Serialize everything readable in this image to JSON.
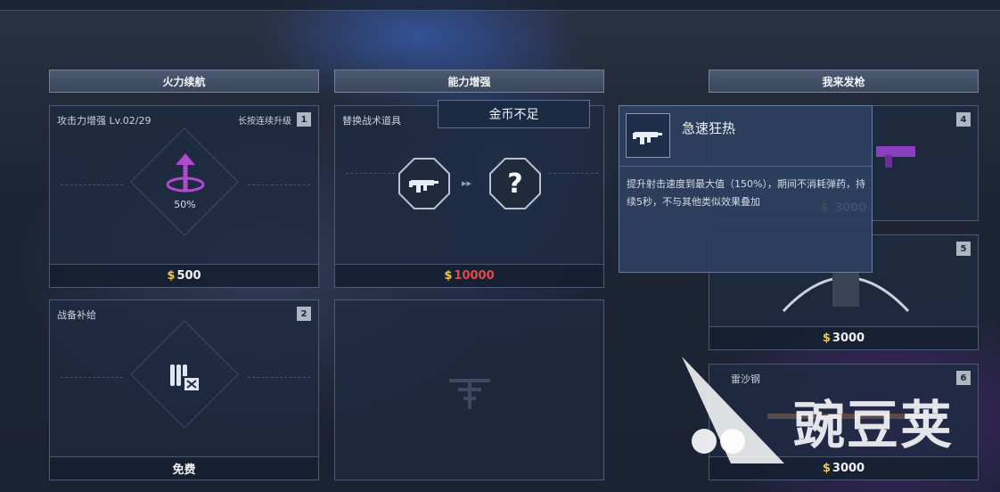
{
  "columns": [
    {
      "header": "火力续航"
    },
    {
      "header": "能力增强"
    },
    {
      "header": "我来发枪"
    }
  ],
  "cards": {
    "attack": {
      "title": "攻击力增强 Lv.02/29",
      "hint": "长按连续升级",
      "number": "1",
      "percent": "50%",
      "price": "500",
      "currency": "$"
    },
    "supply": {
      "title": "战备补给",
      "number": "2",
      "price": "免费"
    },
    "tactical": {
      "title": "替换战术道具",
      "unknown": "?",
      "price": "10000",
      "currency": "$"
    },
    "gun4": {
      "number": "4",
      "price": "3000",
      "currency": "$"
    },
    "gun5": {
      "number": "5",
      "price": "3000",
      "currency": "$"
    },
    "gun6": {
      "title": "雷沙钢",
      "number": "6",
      "price": "3000",
      "currency": "$"
    }
  },
  "popup": {
    "text": "金币不足"
  },
  "tooltip": {
    "name": "急速狂热",
    "desc": "提升射击速度到最大值（150%），期间不消耗弹药，持续5秒，不与其他类似效果叠加"
  },
  "watermark": {
    "text": "豌豆荚"
  },
  "colors": {
    "coin": "#f0c83c",
    "insufficient": "#e04a4a",
    "accent_purple": "#b04ad0"
  }
}
